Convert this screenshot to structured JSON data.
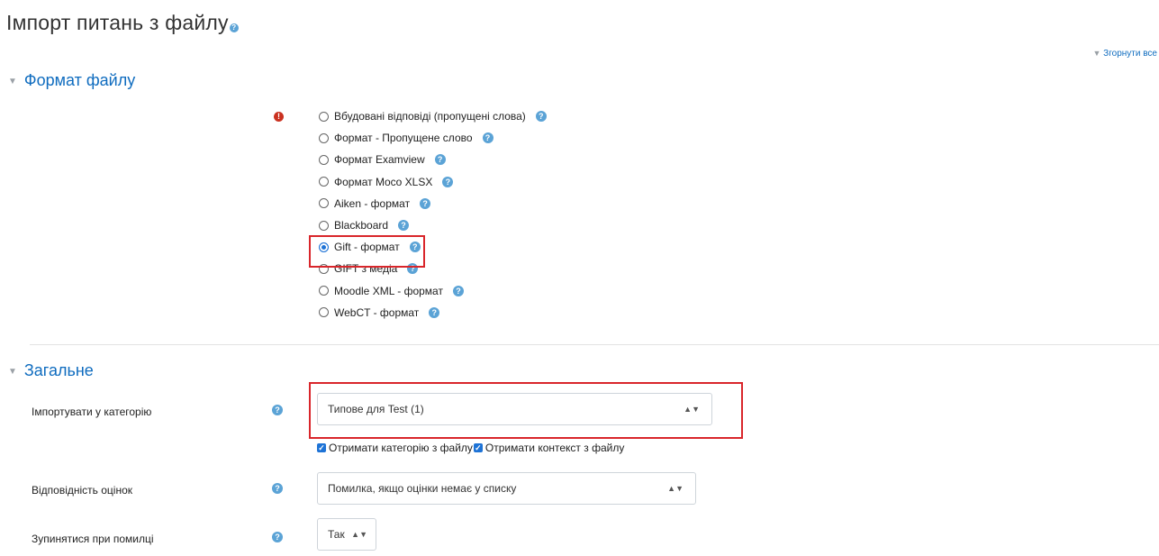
{
  "page": {
    "title": "Імпорт питань з файлу",
    "collapse_all": "Згорнути все"
  },
  "sections": {
    "format": {
      "title": "Формат файлу"
    },
    "general": {
      "title": "Загальне"
    }
  },
  "format_options": [
    {
      "label": "Вбудовані відповіді (пропущені слова)",
      "checked": false
    },
    {
      "label": "Формат - Пропущене слово",
      "checked": false
    },
    {
      "label": "Формат Examview",
      "checked": false
    },
    {
      "label": "Формат Moco XLSX",
      "checked": false
    },
    {
      "label": "Aiken - формат",
      "checked": false
    },
    {
      "label": "Blackboard",
      "checked": false
    },
    {
      "label": "Gift - формат",
      "checked": true
    },
    {
      "label": "GIFT з медіа",
      "checked": false
    },
    {
      "label": "Moodle XML - формат",
      "checked": false
    },
    {
      "label": "WebCT - формат",
      "checked": false
    }
  ],
  "general": {
    "category_label": "Імпортувати у категорію",
    "category_value": "Типове для Test (1)",
    "from_file_category": "Отримати категорію з файлу",
    "from_file_context": "Отримати контекст з файлу",
    "grade_match_label": "Відповідність оцінок",
    "grade_match_value": "Помилка, якщо оцінки немає у списку",
    "stop_on_error_label": "Зупинятися при помилці",
    "stop_on_error_value": "Так"
  },
  "colors": {
    "link": "#0f6cbf",
    "highlight_box": "#d9262b",
    "help_icon": "#5ba3d6",
    "required_icon": "#ca3120"
  }
}
